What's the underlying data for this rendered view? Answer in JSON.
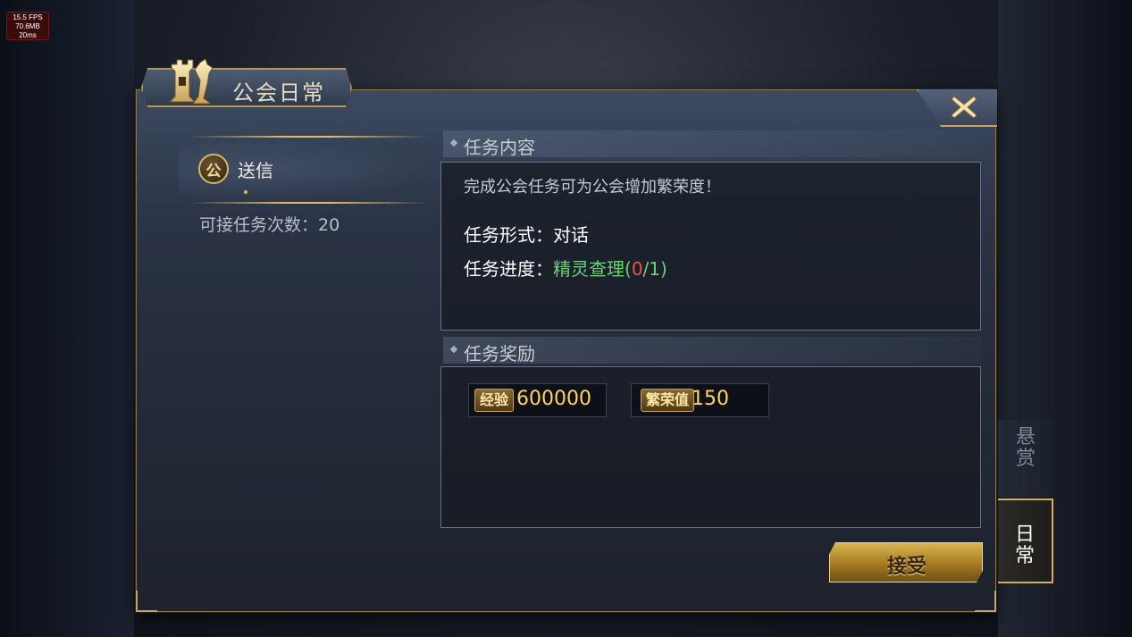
{
  "debug": {
    "fps": "15.5 FPS",
    "memory": "70.6MB",
    "latency": "20ms"
  },
  "window": {
    "title": "公会日常"
  },
  "task_list": {
    "items": [
      {
        "badge": "公",
        "label": "送信"
      }
    ],
    "remaining": "可接任务次数：20"
  },
  "content": {
    "header": "任务内容",
    "description": "完成公会任务可为公会增加繁荣度！",
    "form_label": "任务形式：",
    "form_value": "对话",
    "progress_label": "任务进度：",
    "progress_target": "精灵查理",
    "progress_open": "(",
    "progress_current": "0",
    "progress_total": "/1)"
  },
  "rewards": {
    "header": "任务奖励",
    "items": [
      {
        "tag": "经验",
        "value": "600000"
      },
      {
        "tag": "繁荣值",
        "value": "150"
      }
    ]
  },
  "side_tabs": [
    {
      "chars": [
        "悬",
        "赏"
      ],
      "active": false
    },
    {
      "chars": [
        "日",
        "常"
      ],
      "active": true
    }
  ],
  "actions": {
    "accept": "接受"
  },
  "colors": {
    "gold": "#c6a25a",
    "progress_target": "#6ad07a",
    "progress_current": "#f0504a",
    "reward_value": "#ffd55e"
  }
}
